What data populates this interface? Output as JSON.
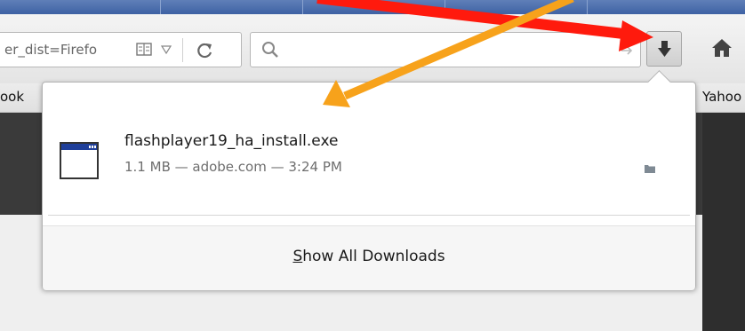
{
  "navbar": {
    "url_text": "er_dist=Firefo",
    "search_placeholder": ""
  },
  "bookmarks": {
    "left_partial": "ook",
    "right_partial": "Yahoo"
  },
  "downloads_panel": {
    "item": {
      "file_name": "flashplayer19_ha_install.exe",
      "meta": "1.1 MB — adobe.com — 3:24 PM"
    },
    "show_all": {
      "first_letter": "S",
      "rest": "how All Downloads"
    }
  },
  "annotations": {
    "red_arrow_color": "#ff1a0d",
    "orange_arrow_color": "#f7a21b"
  }
}
